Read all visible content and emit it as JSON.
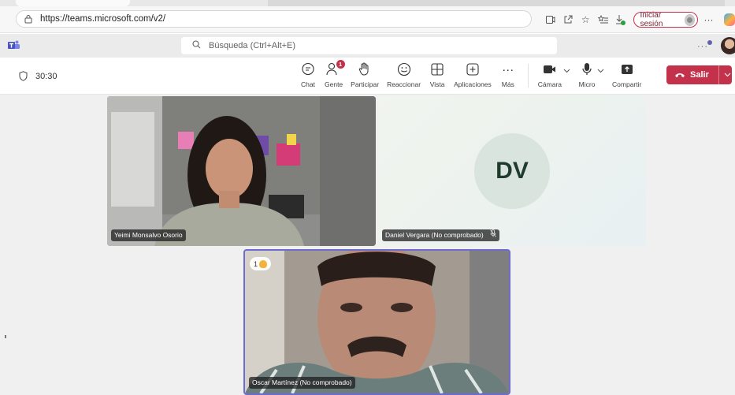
{
  "browser": {
    "url": "https://teams.microsoft.com/v2/",
    "signin_label": "Iniciar sesión",
    "more_label": "···"
  },
  "teams": {
    "search_placeholder": "Búsqueda (Ctrl+Alt+E)",
    "top_more": "···"
  },
  "meeting": {
    "timer": "30:30",
    "tools": {
      "chat": "Chat",
      "people": "Gente",
      "people_badge": "1",
      "raise": "Participar",
      "react": "Reaccionar",
      "view": "Vista",
      "apps": "Aplicaciones",
      "more": "Más",
      "more_icon": "···",
      "camera": "Cámara",
      "mic": "Micro",
      "share": "Compartir"
    },
    "leave_label": "Salir"
  },
  "participants": [
    {
      "name": "Yeimi Monsalvo Osorio"
    },
    {
      "name": "Daniel Vergara (No comprobado)",
      "initials": "DV"
    },
    {
      "name": "Oscar Martínez (No comprobado)",
      "raised_count": "1"
    }
  ],
  "colors": {
    "accent": "#6264a7",
    "leave": "#c4314b",
    "active_tile_border": "#6b6bd0"
  }
}
